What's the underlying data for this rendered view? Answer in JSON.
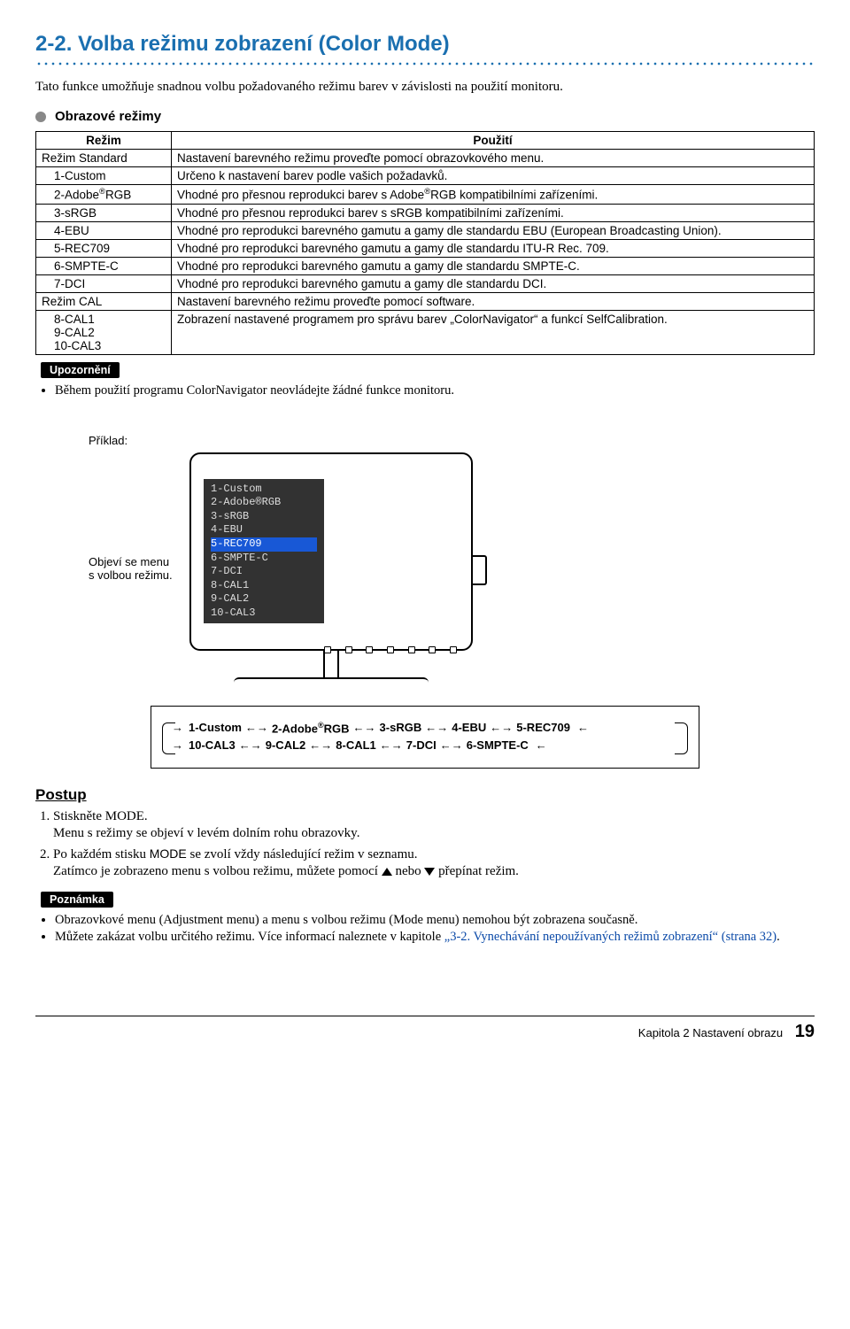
{
  "title": "2-2.  Volba režimu zobrazení (Color Mode)",
  "intro": "Tato funkce umožňuje snadnou volbu požadovaného režimu barev v závislosti na použití monitoru.",
  "sub_heading": "Obrazové režimy",
  "table": {
    "h1": "Režim",
    "h2": "Použití",
    "rows": [
      {
        "mode": "Režim Standard",
        "desc": "Nastavení barevného režimu proveďte pomocí obrazovkového menu.",
        "indent": false
      },
      {
        "mode": "1-Custom",
        "desc": "Určeno k nastavení barev podle vašich požadavků.",
        "indent": true
      },
      {
        "mode": "2-Adobe®RGB",
        "desc": "Vhodné pro přesnou reprodukci barev s Adobe®RGB kompatibilními zařízeními.",
        "indent": true
      },
      {
        "mode": "3-sRGB",
        "desc": "Vhodné pro přesnou reprodukci barev s sRGB kompatibilními zařízeními.",
        "indent": true
      },
      {
        "mode": "4-EBU",
        "desc": "Vhodné pro reprodukci barevného gamutu a gamy dle standardu EBU (European Broadcasting Union).",
        "indent": true
      },
      {
        "mode": "5-REC709",
        "desc": "Vhodné pro reprodukci barevného gamutu a gamy dle standardu ITU-R Rec. 709.",
        "indent": true
      },
      {
        "mode": "6-SMPTE-C",
        "desc": "Vhodné pro reprodukci barevného gamutu a gamy dle standardu SMPTE-C.",
        "indent": true
      },
      {
        "mode": "7-DCI",
        "desc": "Vhodné pro reprodukci barevného gamutu a gamy dle standardu DCI.",
        "indent": true
      },
      {
        "mode": "Režim CAL",
        "desc": "Nastavení barevného režimu proveďte pomocí software.",
        "indent": false
      },
      {
        "mode": "8-CAL1\n9-CAL2\n10-CAL3",
        "desc": "Zobrazení nastavené programem pro správu barev „ColorNavigator“ a funkcí SelfCalibration.",
        "indent": true
      }
    ]
  },
  "upozorneni_label": "Upozornění",
  "upozorneni_item": "Během použití programu ColorNavigator neovládejte žádné funkce monitoru.",
  "example_label": "Příklad:",
  "example_caption": "Objeví se menu s volbou režimu.",
  "osd": {
    "items": [
      "1-Custom",
      "2-Adobe®RGB",
      "3-sRGB",
      "4-EBU",
      "5-REC709",
      "6-SMPTE-C",
      "7-DCI",
      "8-CAL1",
      "9-CAL2",
      "10-CAL3"
    ],
    "highlight_index": 4
  },
  "cycle": {
    "row1": [
      "1-Custom",
      "2-Adobe®RGB",
      "3-sRGB",
      "4-EBU",
      "5-REC709"
    ],
    "row2": [
      "10-CAL3",
      "9-CAL2",
      "8-CAL1",
      "7-DCI",
      "6-SMPTE-C"
    ]
  },
  "procedure_title": "Postup",
  "steps": {
    "s1": "Stiskněte MODE.",
    "s1b": "Menu s režimy se objeví v levém dolním rohu obrazovky.",
    "s2a": "Po každém stisku ",
    "s2_key": "MODE",
    "s2b": " se zvolí vždy následující režim v seznamu.",
    "s2c_a": "Zatímco je zobrazeno menu s volbou režimu, můžete pomocí ",
    "s2c_b": " nebo ",
    "s2c_c": " přepínat režim."
  },
  "poznamka_label": "Poznámka",
  "poznamka": {
    "n1": "Obrazovkové menu (Adjustment menu) a menu s volbou režimu (Mode menu) nemohou být zobrazena současně.",
    "n2a": "Můžete zakázat volbu určitého režimu. Více informací naleznete v kapitole ",
    "n2_link": "„3-2. Vynechávání nepoužívaných režimů zobrazení“ (strana 32)",
    "n2b": "."
  },
  "footer_chapter": "Kapitola 2 Nastavení obrazu",
  "footer_page": "19"
}
